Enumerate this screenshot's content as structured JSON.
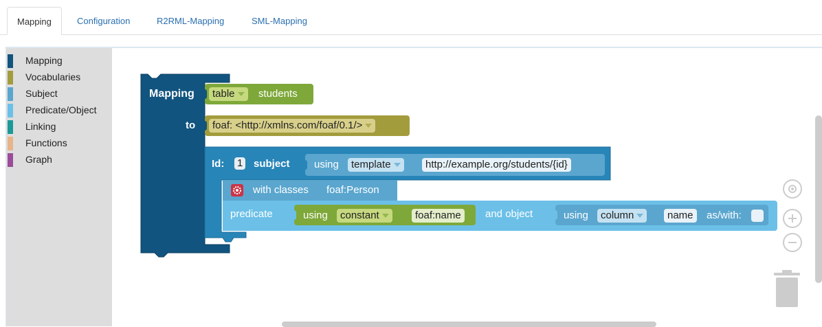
{
  "tabs": [
    {
      "label": "Mapping",
      "active": true
    },
    {
      "label": "Configuration",
      "active": false
    },
    {
      "label": "R2RML-Mapping",
      "active": false
    },
    {
      "label": "SML-Mapping",
      "active": false
    }
  ],
  "toolbox": {
    "items": [
      {
        "label": "Mapping",
        "color": "#11547f"
      },
      {
        "label": "Vocabularies",
        "color": "#a39c3d"
      },
      {
        "label": "Subject",
        "color": "#5aa6cf"
      },
      {
        "label": "Predicate/Object",
        "color": "#6cc0e8"
      },
      {
        "label": "Linking",
        "color": "#1b9a97"
      },
      {
        "label": "Functions",
        "color": "#e8b48a"
      },
      {
        "label": "Graph",
        "color": "#9b4b9b"
      }
    ]
  },
  "workspace": {
    "mapping_block": {
      "label": "Mapping",
      "to_label": "to",
      "color": "#11547f"
    },
    "table_block": {
      "dropdown": "table",
      "value": "students",
      "color": "#7ea83a",
      "field_color": "#c6d97f"
    },
    "vocab_block": {
      "dropdown": "foaf: <http://xmlns.com/foaf/0.1/>",
      "color": "#a39c3d",
      "field_color": "#d8d08a"
    },
    "subject_block": {
      "id_label": "Id:",
      "id_value": "1",
      "subject_label": "subject",
      "color": "#2885b8"
    },
    "template_block": {
      "using_label": "using",
      "dropdown": "template",
      "value": "http://example.org/students/{id}",
      "color": "#5aa6cf"
    },
    "class_block": {
      "label": "with classes",
      "value": "foaf:Person",
      "color": "#5aa6cf",
      "gear_color": "#cc3344"
    },
    "predicate_block": {
      "predicate_label": "predicate",
      "and_object_label": "and object",
      "color": "#6cc0e8"
    },
    "constant_block": {
      "using_label": "using",
      "dropdown": "constant",
      "value": "foaf:name",
      "color": "#7ea83a"
    },
    "column_block": {
      "using_label": "using",
      "dropdown": "column",
      "value": "name",
      "as_with_label": "as/with:",
      "color": "#5aa6cf"
    }
  }
}
